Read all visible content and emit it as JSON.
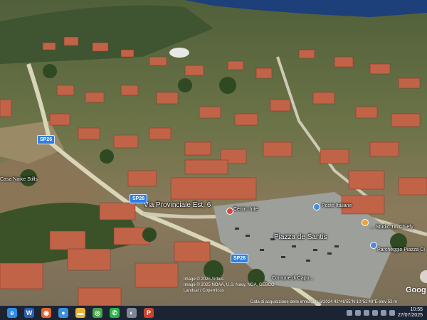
{
  "map": {
    "labels": {
      "via_provinciale": "Via Provinciale Est, 6",
      "piazza_de_santis": "Piazza de Santis",
      "poste_italiane": "Poste Italiane",
      "parcheggio": "Parcheggio Piazza Ci",
      "casa": "Casa Naike Stills",
      "centro": "Centro Inte",
      "farmacia": "... Studio Tin Chiefy",
      "comune": "Comune di Capo..."
    },
    "road_shields": {
      "sp26_left": "SP26",
      "sp26_mid": "SP26",
      "sp26_bottom": "SP26"
    },
    "watermark": "Goog",
    "credits": {
      "line1": "Image © 2025 Airbus",
      "line2": "Image © 2025 NOAA, U.S. Navy, NGA, GEBCO",
      "line3": "Landsat / Copernicus"
    },
    "acquisition": "Data di acquisizione delle immagini: 6/2024   42°46'55\"N 10°52'49\"E  elev 52 m"
  },
  "taskbar": {
    "apps": [
      {
        "name": "edge-icon",
        "glyph": "e",
        "color": "#2f8de4"
      },
      {
        "name": "word-icon",
        "glyph": "W",
        "color": "#2b5fb6"
      },
      {
        "name": "firefox-icon",
        "glyph": "◉",
        "color": "#e2662a"
      },
      {
        "name": "earth-icon",
        "glyph": "●",
        "color": "#3b90d8"
      },
      {
        "name": "folder-icon",
        "glyph": "▬",
        "color": "#e8b43a"
      },
      {
        "name": "chrome-icon",
        "glyph": "◎",
        "color": "#49a24a"
      },
      {
        "name": "whatsapp-icon",
        "glyph": "✆",
        "color": "#2bb34a"
      },
      {
        "name": "app-icon",
        "glyph": "◐",
        "color": "#7e8796"
      },
      {
        "name": "powerpoint-icon",
        "glyph": "P",
        "color": "#c8442b"
      }
    ],
    "time": "10:55",
    "date": "27/07/2025"
  }
}
